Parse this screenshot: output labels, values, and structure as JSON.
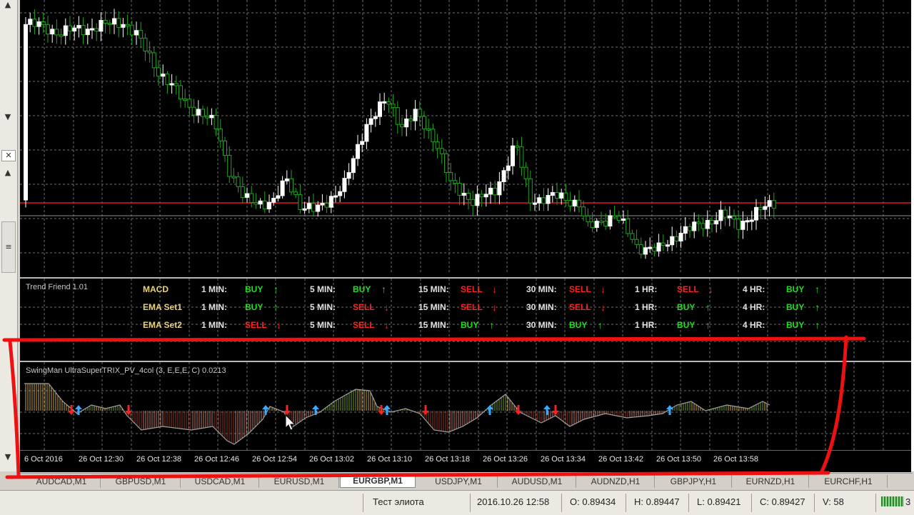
{
  "colors": {
    "background": "#000000",
    "bull": "#ffffff",
    "bear": "#1fa51f",
    "grid": "#6e6e6e",
    "resistance": "#e01818",
    "support": "#8c8c8c",
    "annotation": "#ee1111"
  },
  "trend_pane": {
    "title": "Trend Friend 1.01",
    "rows": [
      {
        "name": "MACD",
        "cells": [
          {
            "tf": "1 MIN:",
            "sig": "BUY",
            "dir": "up"
          },
          {
            "tf": "5 MIN:",
            "sig": "BUY",
            "dir": "up"
          },
          {
            "tf": "15 MIN:",
            "sig": "SELL",
            "dir": "down"
          },
          {
            "tf": "30 MIN:",
            "sig": "SELL",
            "dir": "down"
          },
          {
            "tf": "1 HR:",
            "sig": "SELL",
            "dir": "down"
          },
          {
            "tf": "4 HR:",
            "sig": "BUY",
            "dir": "up"
          }
        ]
      },
      {
        "name": "EMA Set1",
        "cells": [
          {
            "tf": "1 MIN:",
            "sig": "BUY",
            "dir": "up"
          },
          {
            "tf": "5 MIN:",
            "sig": "SELL",
            "dir": "down"
          },
          {
            "tf": "15 MIN:",
            "sig": "SELL",
            "dir": "down"
          },
          {
            "tf": "30 MIN:",
            "sig": "SELL",
            "dir": "down"
          },
          {
            "tf": "1 HR:",
            "sig": "BUY",
            "dir": "up"
          },
          {
            "tf": "4 HR:",
            "sig": "BUY",
            "dir": "up"
          }
        ]
      },
      {
        "name": "EMA Set2",
        "cells": [
          {
            "tf": "1 MIN:",
            "sig": "SELL",
            "dir": "down"
          },
          {
            "tf": "5 MIN:",
            "sig": "SELL",
            "dir": "down"
          },
          {
            "tf": "15 MIN:",
            "sig": "BUY",
            "dir": "up"
          },
          {
            "tf": "30 MIN:",
            "sig": "BUY",
            "dir": "up"
          },
          {
            "tf": "1 HR:",
            "sig": "BUY",
            "dir": "up"
          },
          {
            "tf": "4 HR:",
            "sig": "BUY",
            "dir": "up"
          }
        ]
      }
    ]
  },
  "swing_pane": {
    "title": "SwingMan UltraSuperTRIX_PV_4col (3, E,E,E, C) 0.0213"
  },
  "time_axis": [
    "6 Oct 2016",
    "26 Oct 12:30",
    "26 Oct 12:38",
    "26 Oct 12:46",
    "26 Oct 12:54",
    "26 Oct 13:02",
    "26 Oct 13:10",
    "26 Oct 13:18",
    "26 Oct 13:26",
    "26 Oct 13:34",
    "26 Oct 13:42",
    "26 Oct 13:50",
    "26 Oct 13:58"
  ],
  "tabs": [
    "AUDCAD,M1",
    "GBPUSD,M1",
    "USDCAD,M1",
    "EURUSD,M1",
    "EURGBP,M1",
    "USDJPY,M1",
    "AUDUSD,M1",
    "AUDNZD,H1",
    "GBPJPY,H1",
    "EURNZD,H1",
    "EURCHF,H1"
  ],
  "active_tab": "EURGBP,M1",
  "statusbar": {
    "profile": "Тест элиота",
    "datetime": "2016.10.26 12:58",
    "open": "O: 0.89434",
    "high": "H: 0.89447",
    "low": "L: 0.89421",
    "close": "C: 0.89427",
    "volume": "V: 58",
    "traffic": "3"
  },
  "left_controls": [
    "▲",
    "▼",
    "✕",
    "▲",
    "≡",
    "▼"
  ]
}
